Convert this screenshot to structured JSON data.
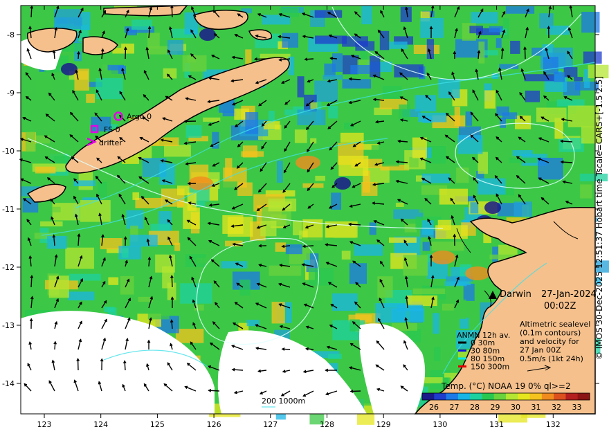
{
  "map": {
    "lon_ticks": [
      "123",
      "124",
      "125",
      "126",
      "127",
      "128",
      "129",
      "130",
      "131",
      "132"
    ],
    "lat_ticks": [
      "-8",
      "-9",
      "-10",
      "-11",
      "-12",
      "-13",
      "-14"
    ],
    "city": "Darwin",
    "date": "27-Jan-2024",
    "time": "00:02Z",
    "markers": {
      "argo": {
        "label": "Argo 0",
        "color": "#e600e6"
      },
      "fs": {
        "label": "FS 0",
        "color": "#e600e6"
      },
      "drifter": {
        "label": "drifter",
        "color": "#e600e6"
      }
    },
    "anmn_legend": {
      "title": "ANMN 12h av.",
      "items": [
        {
          "label": "0 30m",
          "color": "#000000"
        },
        {
          "label": "30 80m",
          "color": "#1010e0"
        },
        {
          "label": "80 150m",
          "color": "#00e6e6"
        },
        {
          "label": "150 300m",
          "color": "#e00000"
        }
      ]
    },
    "altimetry_note": [
      "Altimetric sealevel",
      "(0.1m contours)",
      "and velocity for",
      "27 Jan 00Z",
      "0.5m/s (1kt 24h)"
    ],
    "depth_contours_label": "200  1000m",
    "colorbar": {
      "title": "Temp. (°C) NOAA 19 0% ql>=2",
      "ticks": [
        "26",
        "27",
        "28",
        "29",
        "30",
        "31",
        "32",
        "33"
      ],
      "colors": [
        "#1a1a8c",
        "#1f3ccc",
        "#1e7ae6",
        "#19b5e6",
        "#1ed2a0",
        "#28c850",
        "#6ad23c",
        "#b4e632",
        "#e6e61e",
        "#f5c31e",
        "#f08c1e",
        "#dc501e",
        "#b41e1e",
        "#8c1414"
      ]
    },
    "credit": "© IMOS 30-Dec-2025 12:51:37 Hobart time Tscale=CARS+[-1.5 2.5]",
    "land_color": "#f5c08c"
  }
}
